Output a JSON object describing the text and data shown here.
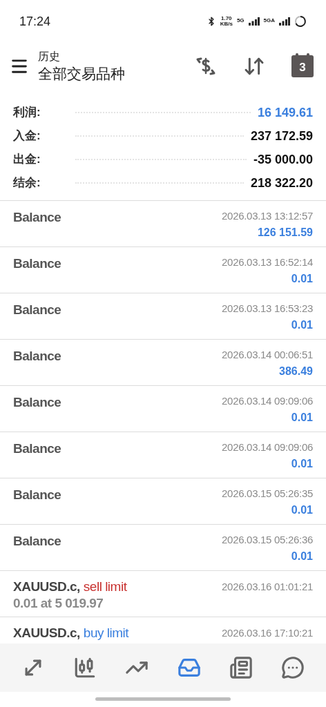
{
  "status_bar": {
    "time": "17:24",
    "speed_value": "1.70",
    "speed_unit": "KB/s",
    "network_1": "5G",
    "network_2": "5GA"
  },
  "header": {
    "subtitle": "历史",
    "title": "全部交易品种",
    "calendar_day": "3"
  },
  "summary": [
    {
      "label": "利润:",
      "value": "16 149.61",
      "kind": "profit"
    },
    {
      "label": "入金:",
      "value": "237 172.59",
      "kind": "plain"
    },
    {
      "label": "出金:",
      "value": "-35 000.00",
      "kind": "plain"
    },
    {
      "label": "结余:",
      "value": "218 322.20",
      "kind": "plain"
    }
  ],
  "rows": [
    {
      "kind": "balance",
      "title": "Balance",
      "time": "2026.03.13 13:12:57",
      "amount": "126 151.59"
    },
    {
      "kind": "balance",
      "title": "Balance",
      "time": "2026.03.13 16:52:14",
      "amount": "0.01"
    },
    {
      "kind": "balance",
      "title": "Balance",
      "time": "2026.03.13 16:53:23",
      "amount": "0.01"
    },
    {
      "kind": "balance",
      "title": "Balance",
      "time": "2026.03.14 00:06:51",
      "amount": "386.49"
    },
    {
      "kind": "balance",
      "title": "Balance",
      "time": "2026.03.14 09:09:06",
      "amount": "0.01"
    },
    {
      "kind": "balance",
      "title": "Balance",
      "time": "2026.03.14 09:09:06",
      "amount": "0.01"
    },
    {
      "kind": "balance",
      "title": "Balance",
      "time": "2026.03.15 05:26:35",
      "amount": "0.01"
    },
    {
      "kind": "balance",
      "title": "Balance",
      "time": "2026.03.15 05:26:36",
      "amount": "0.01"
    },
    {
      "kind": "order",
      "symbol": "XAUUSD.c,",
      "order_type": "sell limit",
      "color": "#c8312f",
      "time": "2026.03.16 01:01:21",
      "detail": "0.01 at 5 019.97"
    },
    {
      "kind": "order",
      "symbol": "XAUUSD.c,",
      "order_type": "buy limit",
      "color": "#3a7fde",
      "time": "2026.03.16 17:10:21"
    }
  ],
  "nav": [
    {
      "kind": "quotes",
      "selected": false
    },
    {
      "kind": "chart",
      "selected": false
    },
    {
      "kind": "trade",
      "selected": false
    },
    {
      "kind": "history",
      "selected": true
    },
    {
      "kind": "news",
      "selected": false
    },
    {
      "kind": "chat",
      "selected": false
    }
  ]
}
